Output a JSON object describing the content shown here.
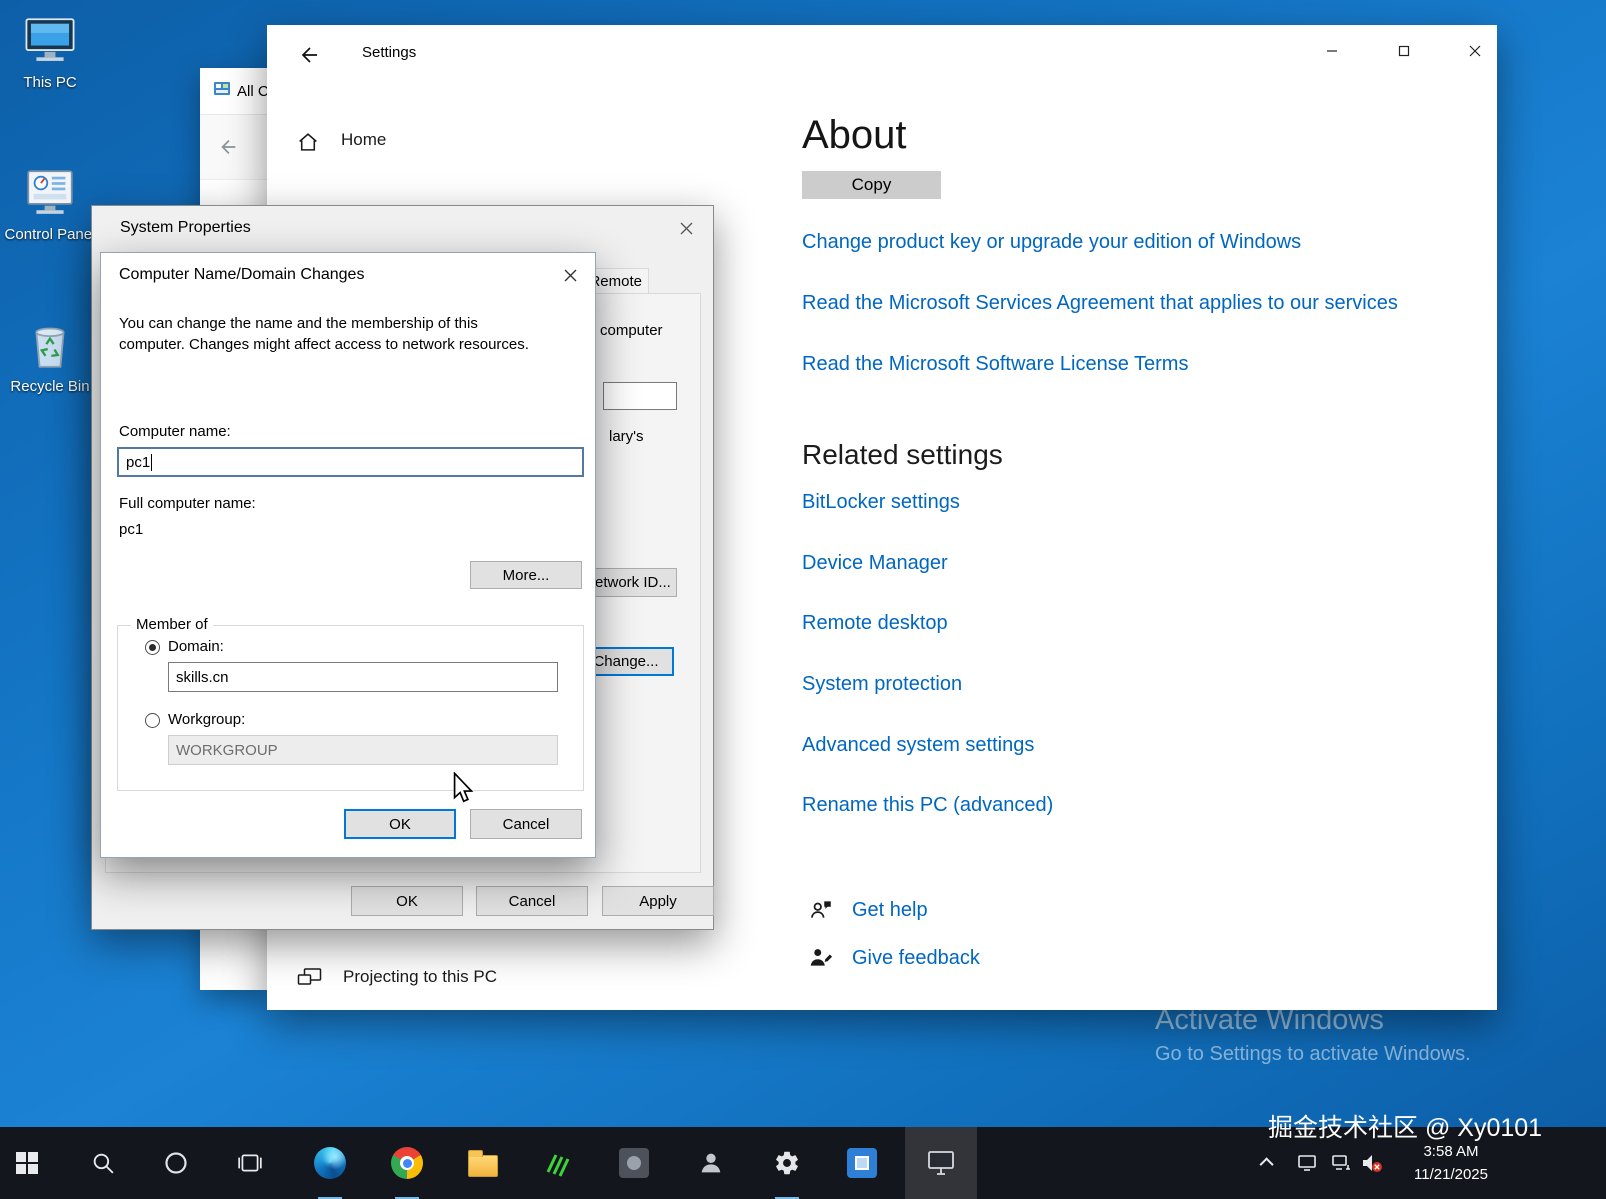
{
  "desktop": {
    "icons": [
      {
        "name": "this-pc",
        "label": "This PC"
      },
      {
        "name": "control-panel",
        "label": "Control Panel"
      },
      {
        "name": "recycle-bin",
        "label": "Recycle Bin"
      }
    ]
  },
  "cp_window": {
    "title": "All Control Panel Items"
  },
  "settings": {
    "title": "Settings",
    "nav_home": "Home",
    "nav_projecting": "Projecting to this PC",
    "about": {
      "heading": "About",
      "copy_button": "Copy",
      "links": [
        {
          "label": "Change product key or upgrade your edition of Windows"
        },
        {
          "label": "Read the Microsoft Services Agreement that applies to our services"
        },
        {
          "label": "Read the Microsoft Software License Terms"
        }
      ],
      "related_heading": "Related settings",
      "related_links": [
        {
          "label": "BitLocker settings"
        },
        {
          "label": "Device Manager"
        },
        {
          "label": "Remote desktop"
        },
        {
          "label": "System protection"
        },
        {
          "label": "Advanced system settings"
        },
        {
          "label": "Rename this PC (advanced)"
        }
      ],
      "get_help": "Get help",
      "give_feedback": "Give feedback"
    }
  },
  "system_properties": {
    "title": "System Properties",
    "remote_tab": "Remote",
    "visible_fragments": {
      "computer": "computer",
      "marys": "lary's"
    },
    "network_id_button": "Network ID...",
    "change_button": "Change...",
    "ok": "OK",
    "cancel": "Cancel",
    "apply": "Apply"
  },
  "name_dialog": {
    "title": "Computer Name/Domain Changes",
    "description_line1": "You can change the name and the membership of this",
    "description_line2": "computer. Changes might affect access to network resources.",
    "computer_name_label": "Computer name:",
    "computer_name_value": "pc1",
    "full_name_label": "Full computer name:",
    "full_name_value": "pc1",
    "more_button": "More...",
    "member_of": "Member of",
    "domain_label": "Domain:",
    "domain_value": "skills.cn",
    "workgroup_label": "Workgroup:",
    "workgroup_value": "WORKGROUP",
    "ok": "OK",
    "cancel": "Cancel"
  },
  "watermarks": {
    "activate_title": "Activate Windows",
    "activate_subtitle": "Go to Settings to activate Windows.",
    "credit": "掘金技术社区 @ Xy0101"
  },
  "taskbar": {
    "time": "3:58 AM",
    "date": "11/21/2025"
  },
  "colors": {
    "accent": "#0078d7",
    "link": "#0067c0",
    "taskbar": "#14161d",
    "desktop": "#1373c2"
  }
}
